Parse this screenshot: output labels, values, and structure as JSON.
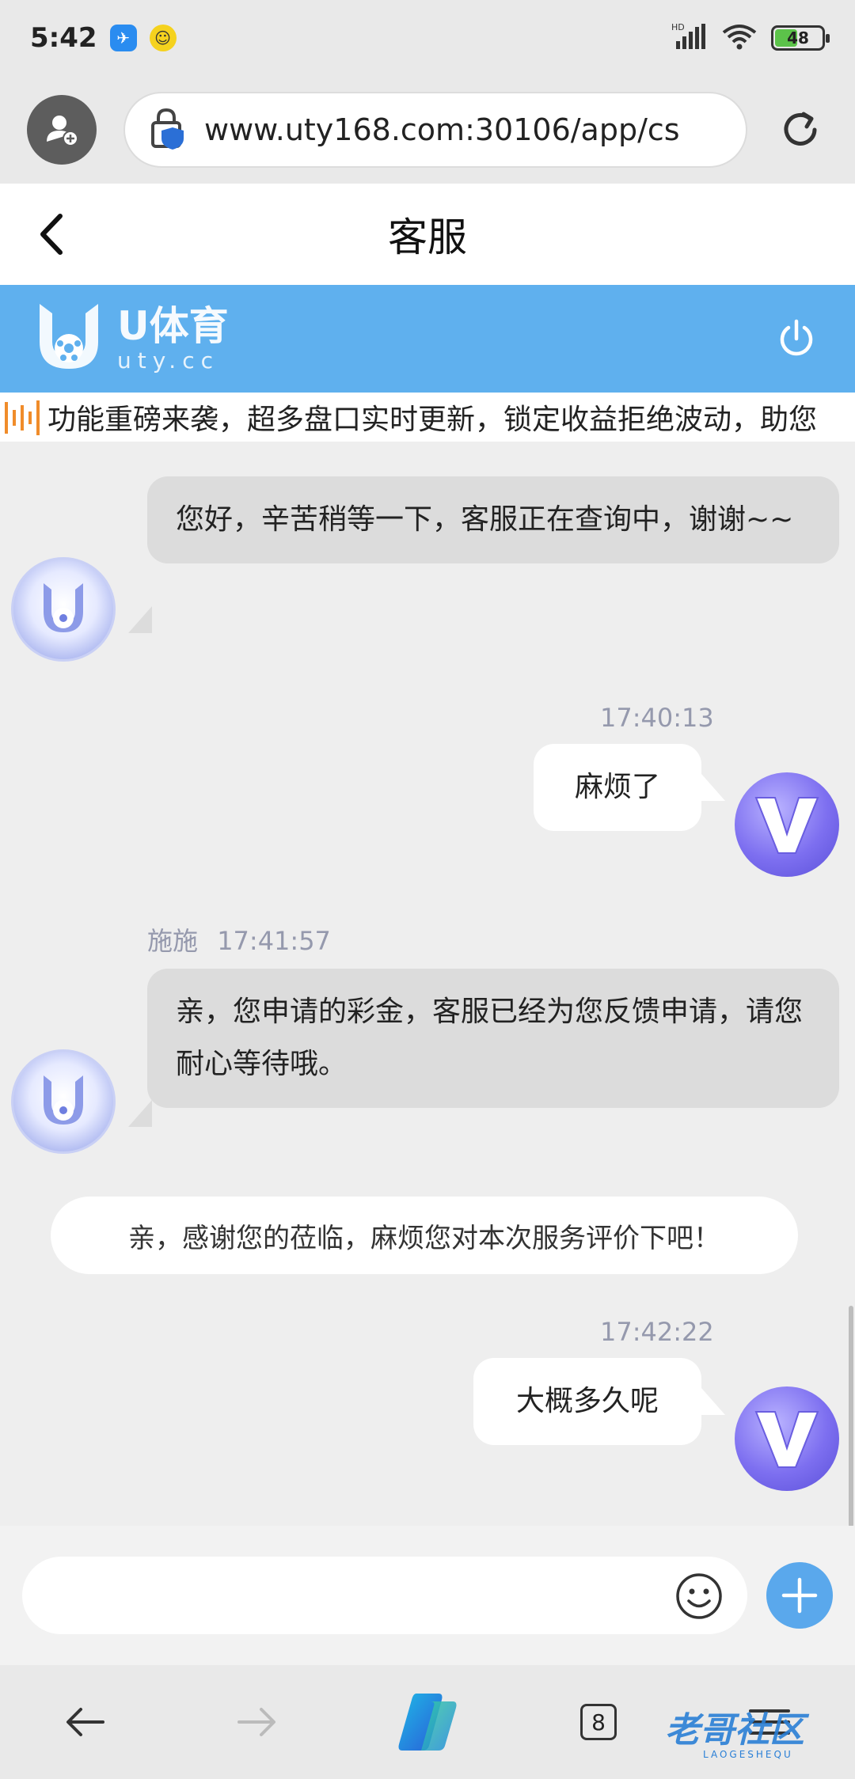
{
  "status_bar": {
    "time": "5:42",
    "network": "HD",
    "battery": "48"
  },
  "browser": {
    "url": "www.uty168.com:30106/app/cs",
    "tabs_count": "8"
  },
  "header": {
    "title": "客服"
  },
  "brand": {
    "name": "U体育",
    "sub": "uty.cc"
  },
  "marquee": {
    "text": "功能重磅来袭，超多盘口实时更新，锁定收益拒绝波动，助您"
  },
  "messages": [
    {
      "side": "left",
      "text": "您好，辛苦稍等一下，客服正在查询中，谢谢~~"
    },
    {
      "side": "right",
      "time": "17:40:13",
      "text": "麻烦了"
    },
    {
      "side": "left",
      "sender": "施施",
      "time": "17:41:57",
      "text": "亲，您申请的彩金，客服已经为您反馈申请，请您耐心等待哦。"
    },
    {
      "side": "system",
      "text": "亲，感谢您的莅临，麻烦您对本次服务评价下吧！"
    },
    {
      "side": "right",
      "time": "17:42:22",
      "text": "大概多久呢"
    }
  ],
  "input": {
    "placeholder": ""
  },
  "watermark": {
    "text": "老哥社区",
    "sub": "LAOGESHEQU"
  },
  "colors": {
    "brand_blue": "#5fb0ee",
    "plus_button": "#5aa8ec",
    "user_avatar": "#7d6ff0",
    "time_text": "#9599ad"
  }
}
